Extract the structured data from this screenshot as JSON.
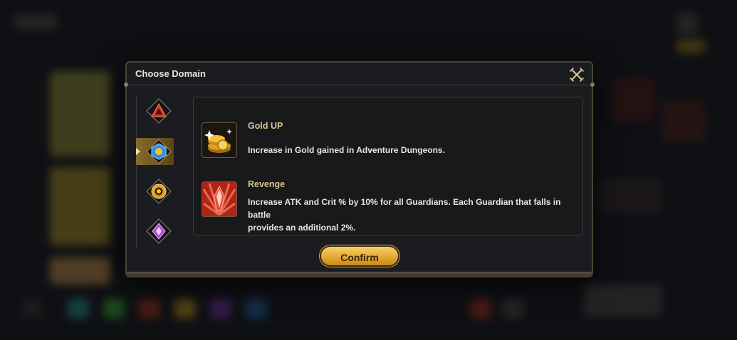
{
  "dialog": {
    "title": "Choose Domain",
    "close_icon": "close-x-icon"
  },
  "domains": [
    {
      "name": "domain-fire",
      "icon": "red-triangle-gem-icon",
      "color": "#d8382a",
      "active": false
    },
    {
      "name": "domain-water",
      "icon": "blue-hexagon-gem-icon",
      "color": "#2e8fe8",
      "active": true
    },
    {
      "name": "domain-earth",
      "icon": "gold-ring-gem-icon",
      "color": "#e8a21e",
      "active": false
    },
    {
      "name": "domain-dark",
      "icon": "purple-crystal-gem-icon",
      "color": "#b24ad8",
      "active": false
    }
  ],
  "buffs": [
    {
      "name": "Gold UP",
      "description": "Increase in Gold gained in Adventure Dungeons.",
      "icon": "gold-coins-icon"
    },
    {
      "name": "Revenge",
      "description_line1": "Increase ATK and Crit % by 10% for all Guardians. Each Guardian that falls in battle",
      "description_line2": "provides an additional 2%.",
      "icon": "red-crystal-burst-icon"
    }
  ],
  "confirm_label": "Confirm",
  "colors": {
    "accent_gold": "#e2a52c",
    "frame": "#4a4336",
    "buff_name": "#d9c190"
  }
}
